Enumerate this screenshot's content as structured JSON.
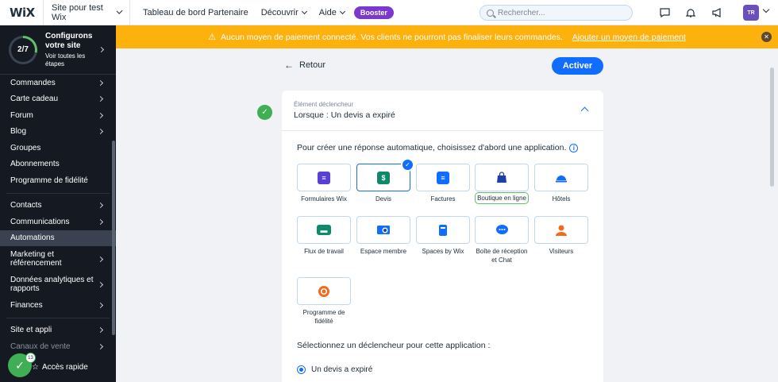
{
  "topbar": {
    "logo": "WiX",
    "site_name": "Site pour test Wix",
    "partner_dashboard": "Tableau de bord Partenaire",
    "discover": "Découvrir",
    "help": "Aide",
    "booster": "Booster",
    "search_placeholder": "Rechercher...",
    "avatar_initials": "TR"
  },
  "sidebar": {
    "setup_progress": "2/7",
    "setup_progress_fraction": 0.2857,
    "setup_title_line1": "Configurons",
    "setup_title_line2": "votre site",
    "setup_sub_line1": "Voir toutes les",
    "setup_sub_line2": "étapes",
    "items": [
      {
        "label": "Commandes",
        "chevron": true
      },
      {
        "label": "Carte cadeau",
        "chevron": true
      },
      {
        "label": "Forum",
        "chevron": true
      },
      {
        "label": "Blog",
        "chevron": true
      },
      {
        "label": "Groupes",
        "chevron": false
      },
      {
        "label": "Abonnements",
        "chevron": false
      },
      {
        "label": "Programme de fidélité",
        "chevron": false
      }
    ],
    "items2": [
      {
        "label": "Contacts",
        "chevron": true
      },
      {
        "label": "Communications",
        "chevron": true
      },
      {
        "label": "Automations",
        "chevron": false,
        "active": true
      },
      {
        "label_line1": "Marketing et",
        "label_line2": "référencement",
        "chevron": true
      },
      {
        "label_line1": "Données analytiques et",
        "label_line2": "rapports",
        "chevron": true
      },
      {
        "label": "Finances",
        "chevron": true
      }
    ],
    "items3": [
      {
        "label": "Site et appli",
        "chevron": true
      },
      {
        "label": "Canaux de vente",
        "chevron": true
      }
    ],
    "quick_access": "Accès rapide",
    "notification_count": "13"
  },
  "banner": {
    "message": "Aucun moyen de paiement connecté. Vos clients ne pourront pas finaliser leurs commandes.",
    "link": "Ajouter un moyen de paiement",
    "color": "#fdb10c"
  },
  "main": {
    "back_label": "Retour",
    "activate_label": "Activer",
    "trigger_label": "Élément déclencheur",
    "trigger_value": "Lorsque : Un devis a expiré",
    "prompt": "Pour créer une réponse automatique, choisissez d'abord une application.",
    "apps": [
      {
        "label": "Formulaires Wix",
        "color": "#5a3fd6",
        "icon": "form-icon"
      },
      {
        "label": "Devis",
        "color": "#0e8a6a",
        "icon": "dollar-doc-icon",
        "selected": true
      },
      {
        "label": "Factures",
        "color": "#116dff",
        "icon": "invoice-icon"
      },
      {
        "label": "Boutique en ligne",
        "color": "#1a3fa8",
        "icon": "shopping-bag-icon",
        "highlighted": true
      },
      {
        "label": "Hôtels",
        "color": "#116dff",
        "icon": "bell-icon"
      },
      {
        "label": "Flux de travail",
        "color": "#0e8a6a",
        "icon": "workflow-icon"
      },
      {
        "label": "Espace membre",
        "color": "#116dff",
        "icon": "member-icon"
      },
      {
        "label": "Spaces by Wix",
        "color": "#116dff",
        "icon": "phone-icon"
      },
      {
        "label_line1": "Boîte de réception",
        "label_line2": "et Chat",
        "color": "#116dff",
        "icon": "chat-icon"
      },
      {
        "label": "Visiteurs",
        "color": "#f26b1d",
        "icon": "visitor-icon"
      },
      {
        "label_line1": "Programme de",
        "label_line2": "fidélité",
        "color": "#f26b1d",
        "icon": "loyalty-icon"
      }
    ],
    "sub_prompt": "Sélectionnez un déclencheur pour cette application :",
    "radio_option": "Un devis a expiré"
  }
}
